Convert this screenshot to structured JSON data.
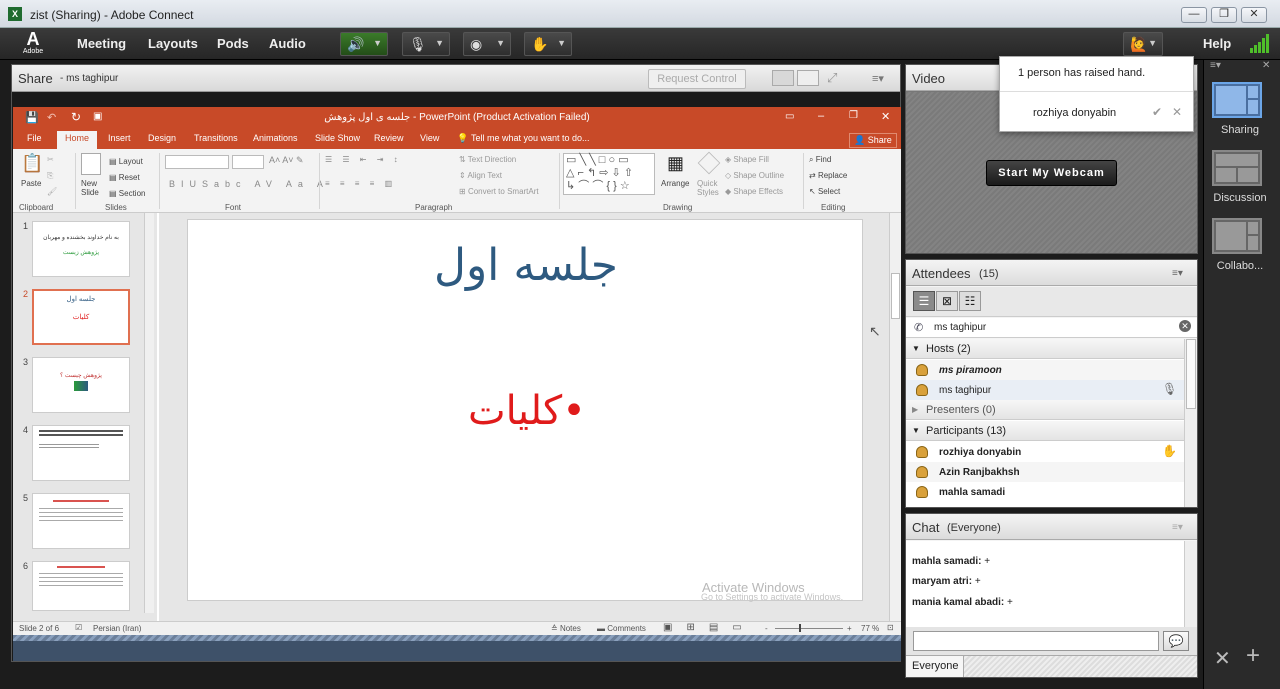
{
  "window": {
    "title": "zist (Sharing) - Adobe Connect"
  },
  "logo": {
    "mark": "A",
    "text": "Adobe"
  },
  "menu": {
    "items": [
      "Meeting",
      "Layouts",
      "Pods",
      "Audio"
    ],
    "help": "Help"
  },
  "share": {
    "title": "Share",
    "presenter": "- ms taghipur",
    "request_control": "Request Control"
  },
  "ppt": {
    "title": "جلسه ی اول پژوهش - PowerPoint (Product Activation Failed)",
    "tabs": [
      "File",
      "Home",
      "Insert",
      "Design",
      "Transitions",
      "Animations",
      "Slide Show",
      "Review",
      "View"
    ],
    "tell_me": "Tell me what you want to do...",
    "share": "Share",
    "ribbon": {
      "paste": "Paste",
      "new_slide": "New Slide",
      "layout": "Layout",
      "reset": "Reset",
      "section": "Section",
      "text_direction": "Text Direction",
      "align_text": "Align Text",
      "convert_smartart": "Convert to SmartArt",
      "arrange": "Arrange",
      "quick_styles": "Quick Styles",
      "shape_fill": "Shape Fill",
      "shape_outline": "Shape Outline",
      "shape_effects": "Shape Effects",
      "find": "Find",
      "replace": "Replace",
      "select": "Select",
      "groups": [
        "Clipboard",
        "Slides",
        "Font",
        "Paragraph",
        "Drawing",
        "Editing"
      ]
    },
    "thumbnails": [
      {
        "num": "1",
        "line1": "به نام خداوند بخشنده و مهربان",
        "line2": "پژوهش زیست"
      },
      {
        "num": "2",
        "line1": "جلسه اول",
        "line2": "کلیات"
      },
      {
        "num": "3",
        "line1": "پژوهش چیست ؟",
        "line2": ""
      },
      {
        "num": "4",
        "line1": "",
        "line2": ""
      },
      {
        "num": "5",
        "line1": "",
        "line2": ""
      },
      {
        "num": "6",
        "line1": "",
        "line2": ""
      }
    ],
    "slide": {
      "title": "جلسه اول",
      "bullet": "کلیات"
    },
    "watermark": {
      "line1": "Activate Windows",
      "line2": "Go to Settings to activate Windows."
    },
    "status": {
      "slide": "Slide 2 of 6",
      "language": "Persian (Iran)",
      "notes": "Notes",
      "comments": "Comments",
      "zoom": "77 %"
    }
  },
  "video": {
    "title": "Video",
    "button": "Start My Webcam"
  },
  "notification": {
    "message": "1 person has raised hand.",
    "name": "rozhiya donyabin"
  },
  "attendees": {
    "title": "Attendees",
    "count": "(15)",
    "me": "ms taghipur",
    "hosts_label": "Hosts (2)",
    "hosts": [
      "ms piramoon",
      "ms taghipur"
    ],
    "presenters_label": "Presenters (0)",
    "participants_label": "Participants (13)",
    "participants": [
      "rozhiya donyabin",
      "Azin Ranjbakhsh",
      "mahla samadi"
    ]
  },
  "chat": {
    "title": "Chat",
    "scope": "(Everyone)",
    "messages": [
      {
        "name": "mahla samadi:",
        "text": "+"
      },
      {
        "name": "maryam atri:",
        "text": "+"
      },
      {
        "name": "mania kamal abadi:",
        "text": "+"
      }
    ],
    "tab": "Everyone"
  },
  "layouts": [
    {
      "label": "Sharing"
    },
    {
      "label": "Discussion"
    },
    {
      "label": "Collabo..."
    }
  ],
  "colors": {
    "ppt_accent": "#c84a28",
    "slide_title": "#2e5a80",
    "slide_bullet": "#e01b1b",
    "selected_layout": "#6ca6e8"
  }
}
